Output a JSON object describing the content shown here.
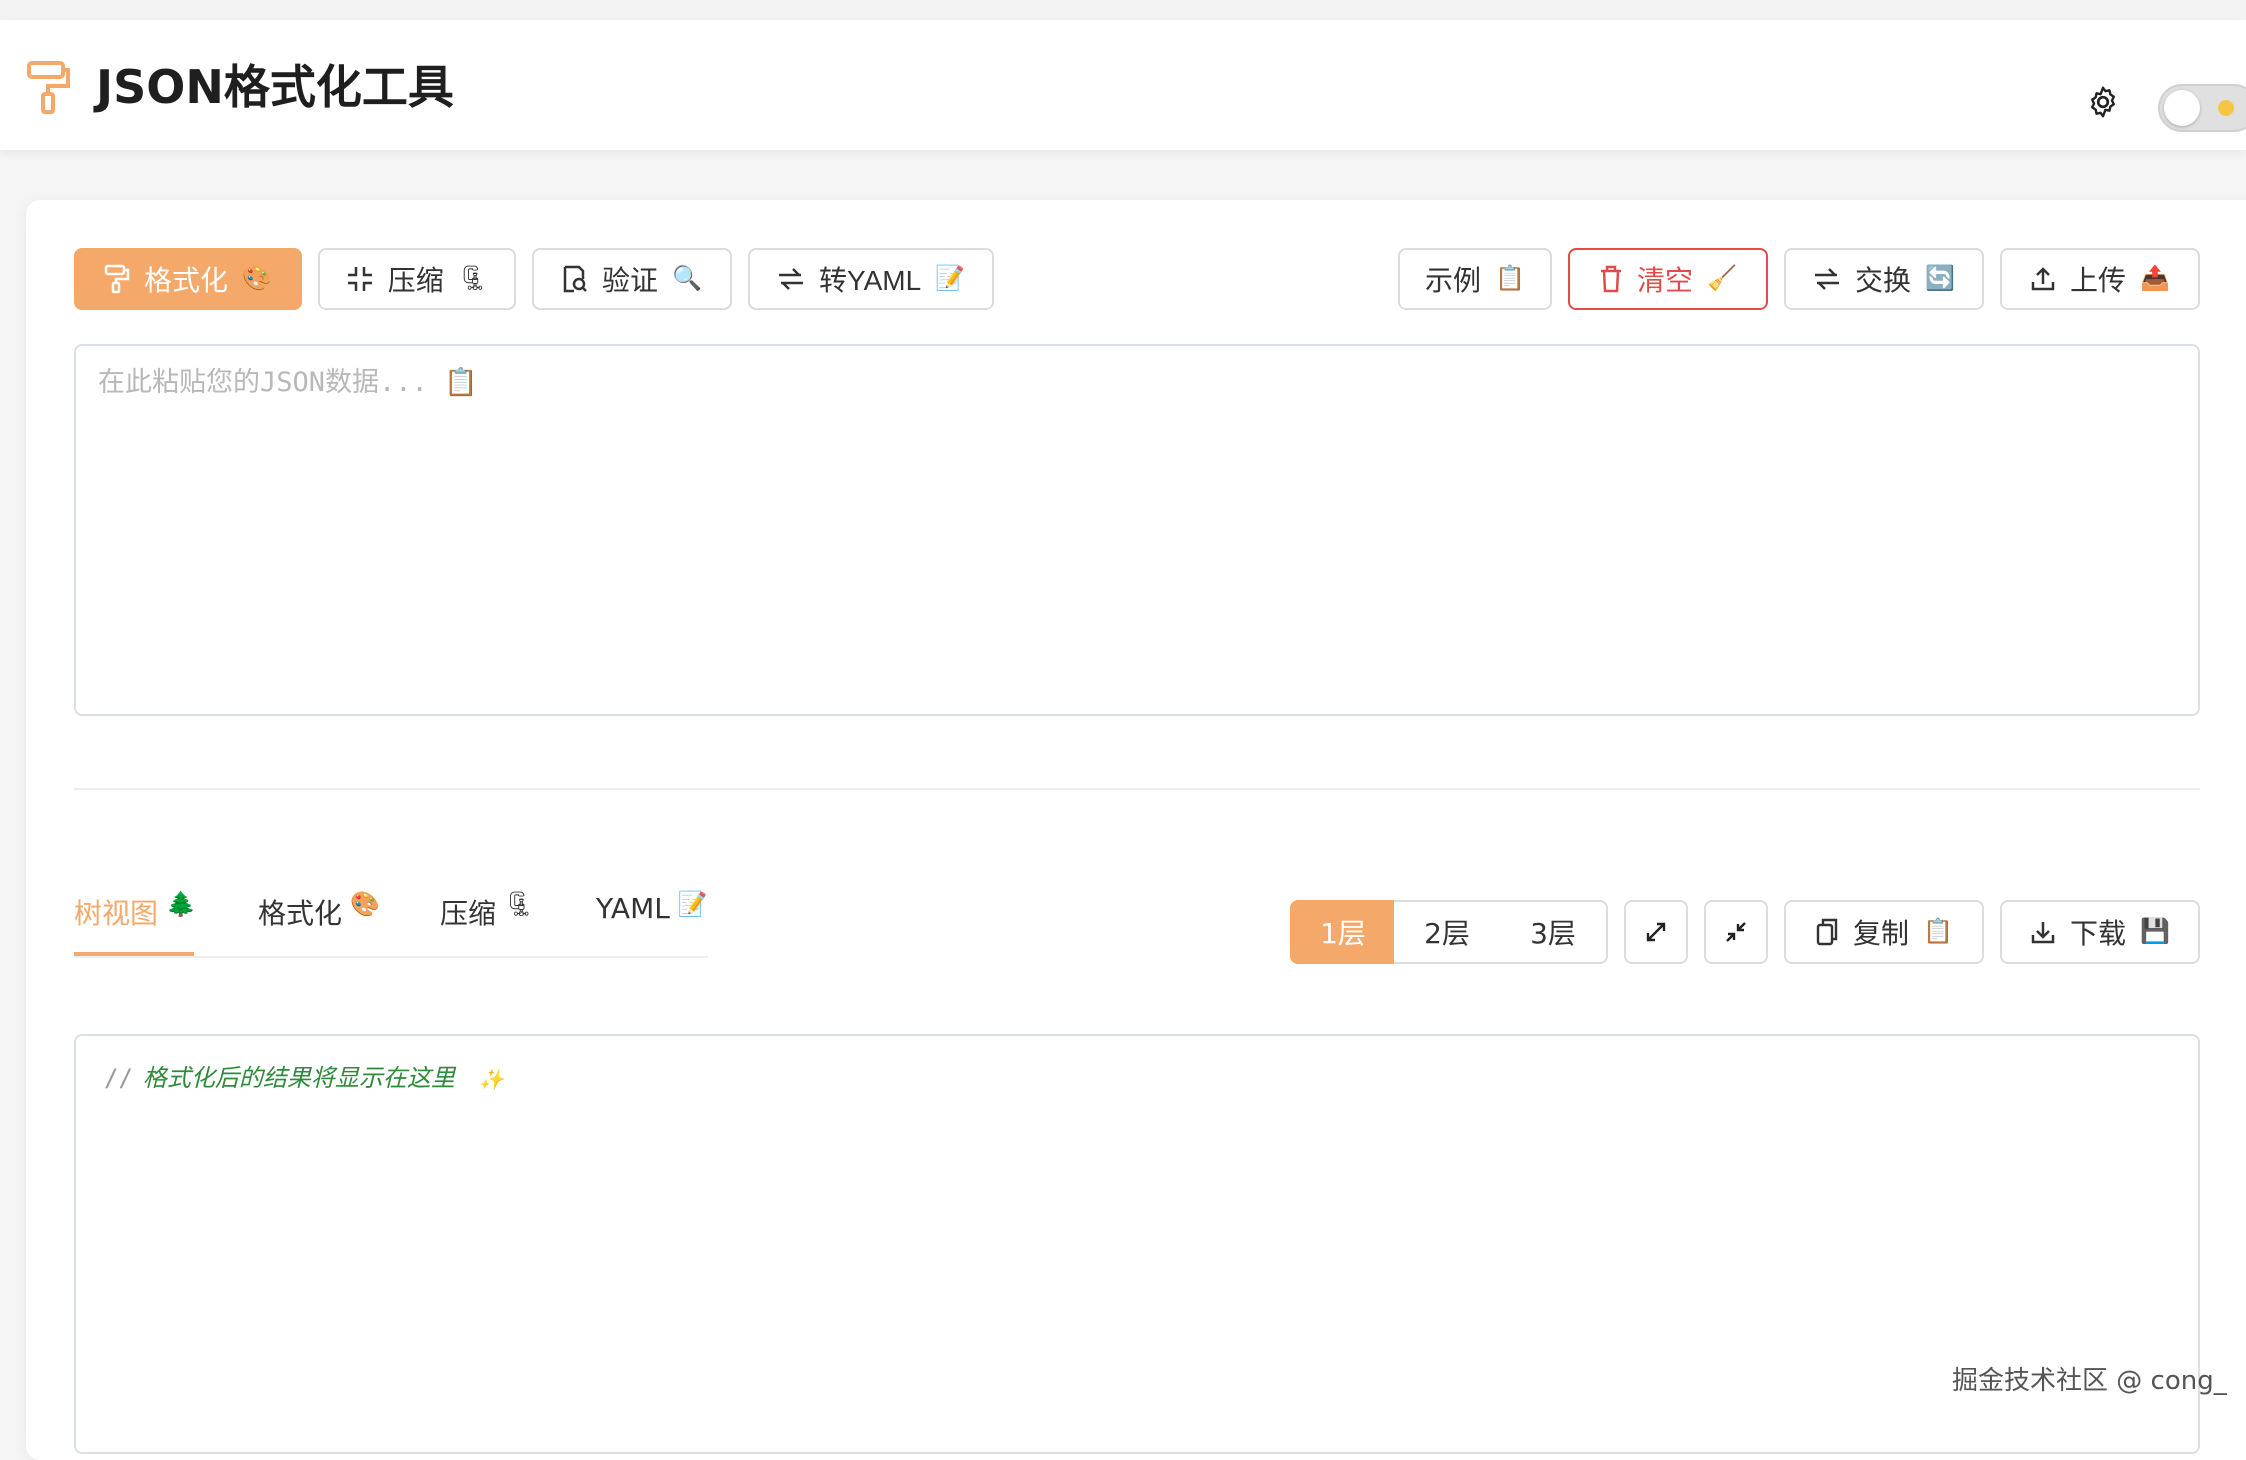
{
  "header": {
    "title": "JSON格式化工具",
    "logo_icon": "paint-roller-icon",
    "settings_icon": "gear-icon",
    "theme_toggle_icon": "sun-icon"
  },
  "toolbar": {
    "format": {
      "label": "格式化",
      "emoji": "🎨"
    },
    "compress": {
      "label": "压缩",
      "emoji": "🗜"
    },
    "validate": {
      "label": "验证",
      "emoji": "🔍"
    },
    "to_yaml": {
      "label": "转YAML",
      "emoji": "📝"
    },
    "example": {
      "label": "示例",
      "emoji": "📋"
    },
    "clear": {
      "label": "清空",
      "emoji": "🧹"
    },
    "swap": {
      "label": "交换",
      "emoji": "🔄"
    },
    "upload": {
      "label": "上传",
      "emoji": "📤"
    }
  },
  "input": {
    "placeholder": "在此粘贴您的JSON数据... 📋",
    "value": ""
  },
  "output_tabs": [
    {
      "label": "树视图",
      "emoji": "🌲",
      "active": true
    },
    {
      "label": "格式化",
      "emoji": "🎨",
      "active": false
    },
    {
      "label": "压缩",
      "emoji": "🗜",
      "active": false
    },
    {
      "label": "YAML",
      "emoji": "📝",
      "active": false
    }
  ],
  "levels": [
    {
      "label": "1层",
      "active": true
    },
    {
      "label": "2层",
      "active": false
    },
    {
      "label": "3层",
      "active": false
    }
  ],
  "output_actions": {
    "expand_icon": "expand-icon",
    "collapse_icon": "collapse-icon",
    "copy": {
      "label": "复制",
      "emoji": "📋"
    },
    "download": {
      "label": "下载",
      "emoji": "💾"
    }
  },
  "output": {
    "comment_prefix": "//",
    "placeholder": "格式化后的结果将显示在这里",
    "emoji": "✨"
  },
  "watermark": "掘金技术社区 @ cong_",
  "colors": {
    "accent": "#f4a86a",
    "danger": "#e34b4b",
    "comment": "#2f8a3a"
  }
}
